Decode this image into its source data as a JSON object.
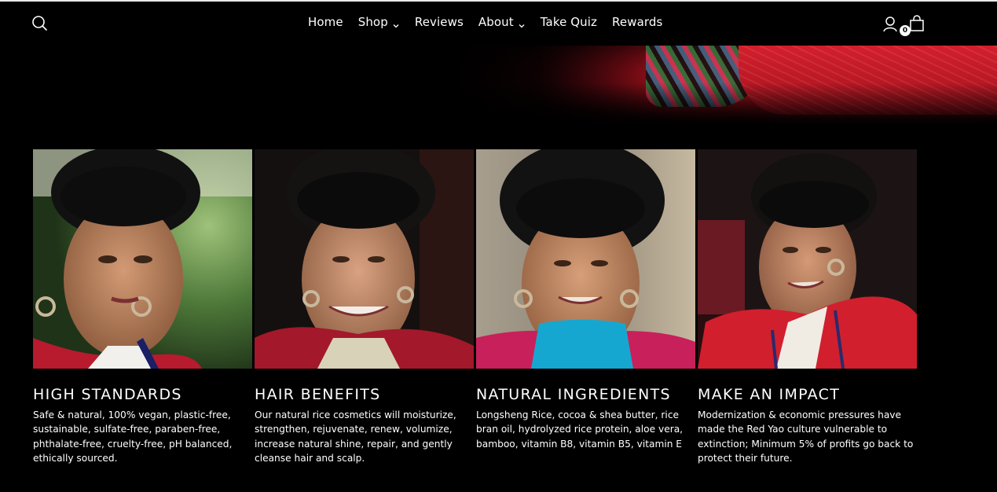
{
  "header": {
    "search_icon": "search-icon",
    "nav": [
      {
        "label": "Home",
        "has_dropdown": false
      },
      {
        "label": "Shop",
        "has_dropdown": true
      },
      {
        "label": "Reviews",
        "has_dropdown": false
      },
      {
        "label": "About",
        "has_dropdown": true
      },
      {
        "label": "Take Quiz",
        "has_dropdown": false
      },
      {
        "label": "Rewards",
        "has_dropdown": false
      }
    ],
    "account_icon": "user-icon",
    "cart_icon": "shopping-bag-icon",
    "cart_count": "0"
  },
  "features": [
    {
      "title": "HIGH STANDARDS",
      "description": "Safe & natural, 100% vegan, plastic-free, sustainable, sulfate-free, paraben-free, phthalate-free, cruelty-free, pH balanced, ethically sourced."
    },
    {
      "title": "HAIR BENEFITS",
      "description": "Our natural rice cosmetics will moisturize, strengthen, rejuvenate, renew, volumize, increase natural shine, repair, and gently cleanse hair and scalp."
    },
    {
      "title": "NATURAL INGREDIENTS",
      "description": "Longsheng Rice, cocoa & shea butter, rice bran oil, hydrolyzed rice protein, aloe vera, bamboo, vitamin B8, vitamin B5, vitamin E"
    },
    {
      "title": "MAKE AN IMPACT",
      "description": "Modernization & economic pressures have made the Red Yao culture vulnerable to extinction; Minimum 5% of profits go back to protect their future."
    }
  ],
  "colors": {
    "background": "#000000",
    "text": "#ffffff",
    "accent_red": "#c8182a"
  }
}
